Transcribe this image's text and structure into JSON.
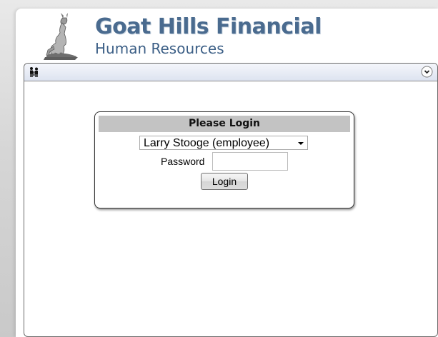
{
  "header": {
    "title": "Goat Hills Financial",
    "subtitle": "Human Resources",
    "logo_icon": "goat-logo",
    "title_color": "#4a6b8f"
  },
  "panel": {
    "left_icon": "users-icon",
    "right_icon": "collapse-chevron-icon"
  },
  "login": {
    "heading": "Please Login",
    "user_select_value": "Larry Stooge (employee)",
    "password_label": "Password",
    "password_value": "",
    "button_label": "Login"
  }
}
